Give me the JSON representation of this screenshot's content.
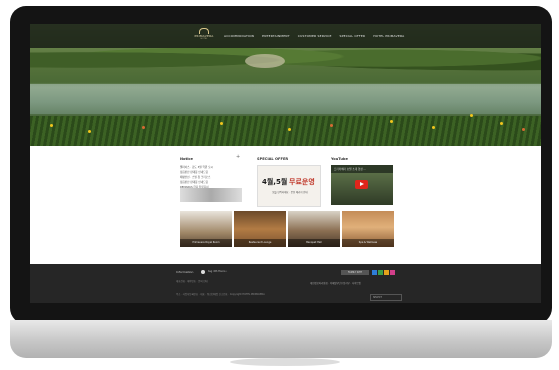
{
  "nav": {
    "logo_text": "PRIMAVERA",
    "logo_sub": "HOTEL",
    "menu": [
      "ACCOMMODATION",
      "ENTERTAINMENT",
      "CUSTOMER SERVICE",
      "SPECIAL OFFER",
      "HOTEL PRIMAVERA"
    ]
  },
  "notice": {
    "title": "Notice",
    "more": "+",
    "items": [
      "웰라이스 · 김도 3월 학원 오시",
      "정읍판산 판대봉 안내드림",
      "폐평안선 · 스넬 청 크리오스",
      "정읍판산 판대봉 안내드림",
      "REMARKS 한다 천류음서"
    ]
  },
  "offer": {
    "title": "SPECIAL OFFER",
    "big": "4월,5월",
    "big_red": "무료운영",
    "small": "봄을 만끽하세요 · 온천 패키지 안내"
  },
  "youtube": {
    "title": "YouTube",
    "caption": "프리마베라 호텔 소개 영상 ..."
  },
  "thumbs": [
    {
      "label": "Primavera Royal Room"
    },
    {
      "label": "Restaurant Lounge"
    },
    {
      "label": "Banquet Hall"
    },
    {
      "label": "Spa & Wellness"
    }
  ],
  "footer": {
    "info_label": "Information",
    "info_sub": "tag 4th floors ›",
    "line1": "대표전화 · 예약번호 · 문의 안내",
    "line2": "주소 · 사업자등록번호 · 대표 · 통신판매업 신고번호 · Copyright HOTEL PRIMAVERA",
    "right_links": "개인정보처리방침 · 이메일무단수집거부 · 사이트맵",
    "family_btn": "FAMILY SITE",
    "select": "SELECT",
    "colors": [
      "#2e7dd7",
      "#3b9e48",
      "#e4a21b",
      "#d23f8a"
    ]
  }
}
